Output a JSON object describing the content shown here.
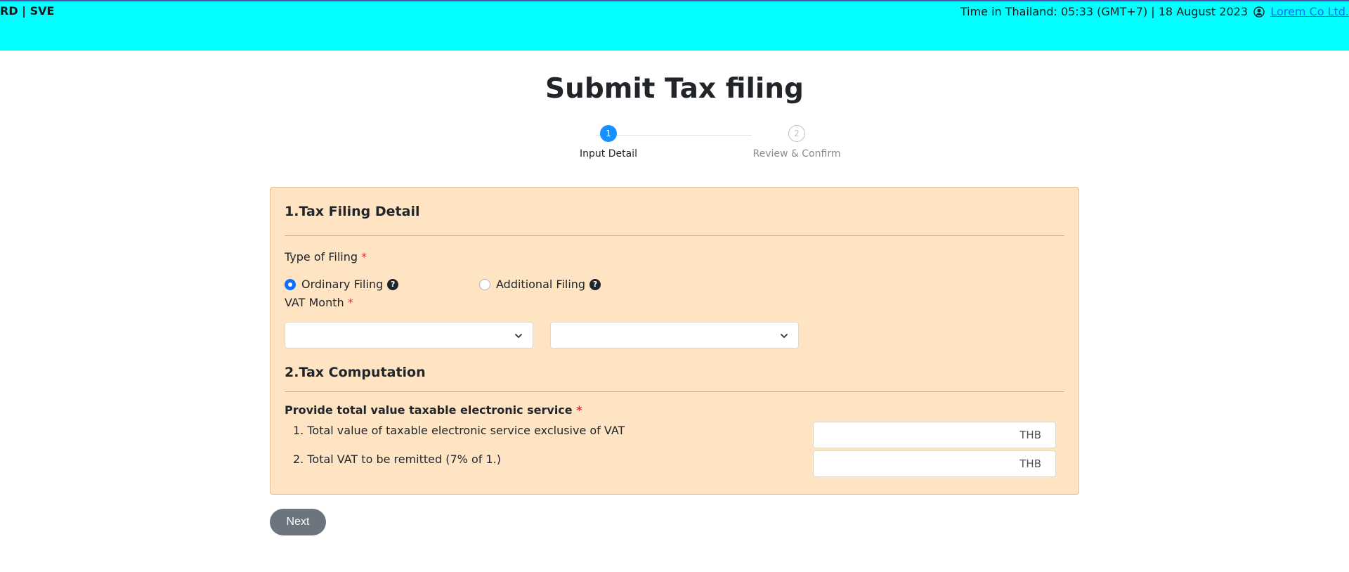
{
  "header": {
    "brand": "RD | SVE",
    "time_info": "Time in Thailand: 05:33 (GMT+7) | 18 August 2023",
    "user_name": "Lorem Co Ltd.",
    "background_color": "#00ffff"
  },
  "page": {
    "title": "Submit Tax filing"
  },
  "stepper": {
    "steps": [
      {
        "number": "1",
        "label": "Input Detail",
        "status": "active"
      },
      {
        "number": "2",
        "label": "Review & Confirm",
        "status": "pending"
      }
    ],
    "active_color": "#1890ff"
  },
  "tax_filing_detail": {
    "title": "1.Tax Filing Detail",
    "type_of_filing_label": "Type of Filing",
    "required_mark": "*",
    "options": [
      {
        "label": "Ordinary Filing",
        "selected": true
      },
      {
        "label": "Additional Filing",
        "selected": false
      }
    ],
    "help_icon_glyph": "?",
    "vat_month_label": "VAT Month",
    "month_select_value": "",
    "year_select_value": ""
  },
  "tax_computation": {
    "title": "2.Tax Computation",
    "provide_label": "Provide total value taxable electronic service",
    "items": [
      {
        "label": "1. Total value of taxable electronic service exclusive of VAT",
        "value": "",
        "unit": "THB"
      },
      {
        "label": "2. Total VAT to be remitted (7% of 1.)",
        "value": "",
        "unit": "THB"
      }
    ]
  },
  "actions": {
    "next_label": "Next"
  },
  "colors": {
    "card_background": "#ffe4c4",
    "required": "#dc3545",
    "button": "#6c757d"
  }
}
